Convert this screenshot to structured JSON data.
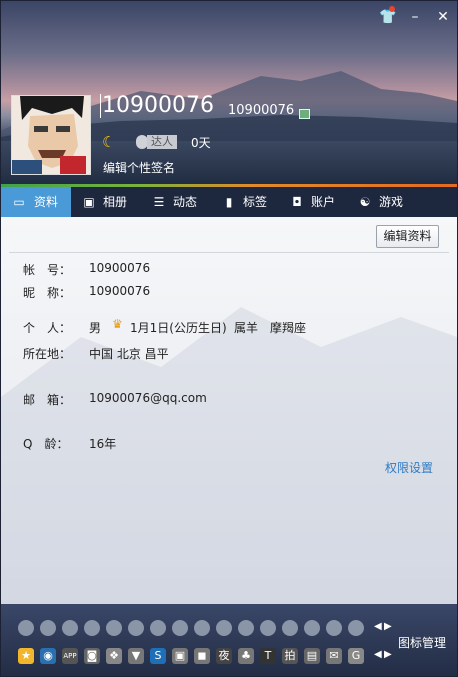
{
  "profile": {
    "nickname": "10900076",
    "qq": "10900076",
    "daren_label": "达人",
    "days": "0天",
    "signature_placeholder": "编辑个性签名"
  },
  "tabs": [
    {
      "label": "资料",
      "icon": "profile-card-icon",
      "active": true
    },
    {
      "label": "相册",
      "icon": "photo-album-icon",
      "active": false
    },
    {
      "label": "动态",
      "icon": "feed-list-icon",
      "active": false
    },
    {
      "label": "标签",
      "icon": "bookmark-tag-icon",
      "active": false
    },
    {
      "label": "账户",
      "icon": "briefcase-icon",
      "active": false
    },
    {
      "label": "游戏",
      "icon": "game-icon",
      "active": false
    }
  ],
  "toolbar": {
    "edit_label": "编辑资料"
  },
  "info": {
    "account_label": "帐　号：",
    "account": "10900076",
    "nick_label": "昵　称：",
    "nick": "10900076",
    "personal_label": "个　人：",
    "gender": "男",
    "birthday": "1月1日(公历生日)",
    "zodiac": "属羊",
    "constellation": "摩羯座",
    "location_label": "所在地：",
    "location": "中国 北京 昌平",
    "email_label": "邮　箱：",
    "email": "10900076@qq.com",
    "qage_label": "Q　龄：",
    "qage": "16年"
  },
  "links": {
    "permissions": "权限设置"
  },
  "bottom": {
    "row1_icons": [
      "a1",
      "a2",
      "a3",
      "a4",
      "a5",
      "a6",
      "a7",
      "a8",
      "a9",
      "a10",
      "a11",
      "a12",
      "a13",
      "a14",
      "a15",
      "a16"
    ],
    "row2_icons": [
      "b1",
      "b2",
      "b3",
      "b4",
      "b5",
      "b6",
      "b7",
      "b8",
      "b9",
      "b10",
      "b11",
      "b12",
      "b13",
      "b14",
      "b15",
      "b16"
    ],
    "row2_icon_text": [
      "★",
      "◉",
      "APP",
      "◙",
      "❖",
      "▼",
      "S",
      "▣",
      "◼",
      "夜",
      "♣",
      "T",
      "拍",
      "▤",
      "✉",
      "G"
    ],
    "icon_manager": "图标管理"
  },
  "colors": {
    "tab_active": "#4a9ad8",
    "link": "#2e7bc4",
    "accent_line": "#e36a22"
  }
}
